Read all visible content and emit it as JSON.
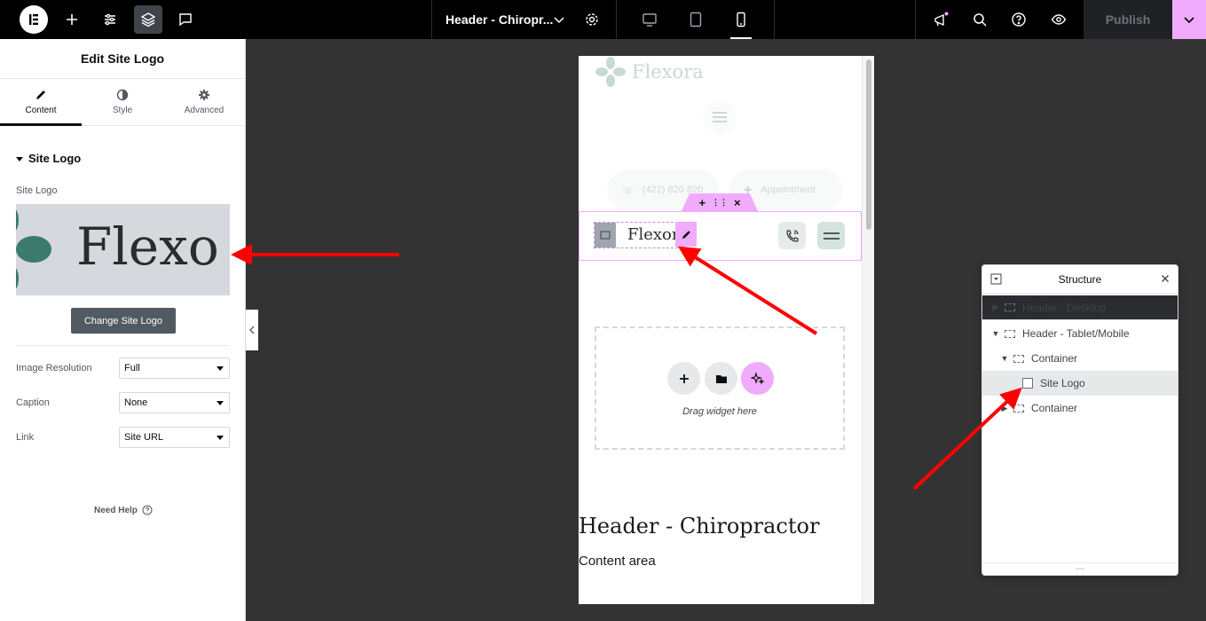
{
  "topbar": {
    "document_title": "Header - Chiropr...",
    "publish_label": "Publish",
    "brand_color": "#f0abfc"
  },
  "panel": {
    "header": "Edit Site Logo",
    "tabs": [
      {
        "label": "Content",
        "icon": "pencil-icon",
        "active": true
      },
      {
        "label": "Style",
        "icon": "half-circle-icon",
        "active": false
      },
      {
        "label": "Advanced",
        "icon": "gear-icon",
        "active": false
      }
    ],
    "section_title": "Site Logo",
    "site_logo_label": "Site Logo",
    "logo_preview_text": "Flexo",
    "change_button": "Change Site Logo",
    "fields": [
      {
        "label": "Image Resolution",
        "value": "Full"
      },
      {
        "label": "Caption",
        "value": "None"
      },
      {
        "label": "Link",
        "value": "Site URL"
      }
    ],
    "need_help": "Need Help"
  },
  "canvas": {
    "ghost_brand": "Flexora",
    "ghost_phone": "(422) 820 820",
    "ghost_appointment": "Appointment",
    "logo_text": "Flexora",
    "handle_icons": [
      "+",
      "⋮⋮",
      "×"
    ],
    "drop_text": "Drag widget here",
    "page_title": "Header - Chiropractor",
    "content_area": "Content area"
  },
  "structure": {
    "title": "Structure",
    "items": [
      {
        "label": "Header - Desktop",
        "caret": "▶",
        "level": 0
      },
      {
        "label": "Header - Tablet/Mobile",
        "caret": "▼",
        "level": 0
      },
      {
        "label": "Container",
        "caret": "▼",
        "level": 1
      },
      {
        "label": "Site Logo",
        "caret": "",
        "level": 2
      },
      {
        "label": "Container",
        "caret": "▶",
        "level": 1
      }
    ],
    "footer": "⋯"
  }
}
